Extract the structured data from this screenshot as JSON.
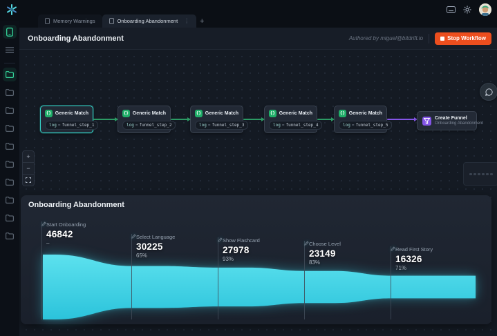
{
  "topbar": {
    "tabs": [
      {
        "label": "Memory Warnings"
      },
      {
        "label": "Onboarding Abandonment"
      }
    ],
    "new_tab_label": "+",
    "tab_menu": "⋮"
  },
  "header": {
    "title": "Onboarding Abandonment",
    "authored_by": "Authored by miguel@bitdrift.io",
    "stop_button_label": "Stop Workflow"
  },
  "workflow": {
    "nodes": [
      {
        "title": "Generic Match",
        "chip": {
          "key": "log",
          "op": "=",
          "value": "funnel_step_1"
        }
      },
      {
        "title": "Generic Match",
        "chip": {
          "key": "log",
          "op": "=",
          "value": "funnel_step_2"
        }
      },
      {
        "title": "Generic Match",
        "chip": {
          "key": "log",
          "op": "=",
          "value": "funnel_step_3"
        }
      },
      {
        "title": "Generic Match",
        "chip": {
          "key": "log",
          "op": "=",
          "value": "funnel_step_4"
        }
      },
      {
        "title": "Generic Match",
        "chip": {
          "key": "log",
          "op": "=",
          "value": "funnel_step_5"
        }
      }
    ],
    "create_node": {
      "title": "Create Funnel",
      "subtitle": "Onboarding Abandonment"
    },
    "zoom_in": "+",
    "zoom_out": "−",
    "node_icon_glyph": "{}"
  },
  "funnel_panel": {
    "title": "Onboarding Abandonment"
  },
  "chart_data": {
    "type": "area",
    "subtype": "funnel",
    "title": "Onboarding Abandonment",
    "steps": [
      {
        "label": "Start Onboarding",
        "value": 46842,
        "percent": "–"
      },
      {
        "label": "Select Language",
        "value": 30225,
        "percent": "65%"
      },
      {
        "label": "Show Flashcard",
        "value": 27978,
        "percent": "93%"
      },
      {
        "label": "Choose Level",
        "value": 23149,
        "percent": "83%"
      },
      {
        "label": "Read First Story",
        "value": 16326,
        "percent": "71%"
      }
    ],
    "colors": {
      "fill_top": "#5ce1ee",
      "fill_bottom": "#2bc3db"
    },
    "layout": {
      "shape": "symmetric horizontal funnel",
      "grid": "off",
      "legend": "none"
    }
  },
  "colors": {
    "accent_teal": "#35d0c5",
    "accent_green": "#1fae68",
    "accent_purple": "#8455e6",
    "stop_orange": "#ec4e1e",
    "funnel_cyan": "#3fd6e8"
  }
}
